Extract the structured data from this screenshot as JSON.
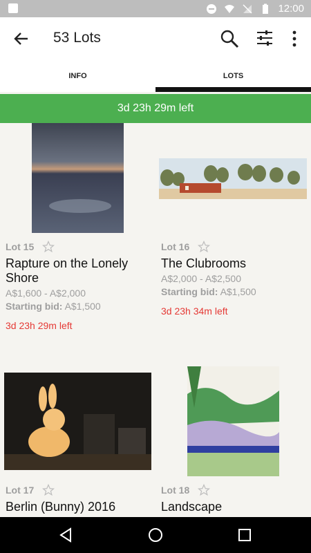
{
  "status_bar": {
    "time": "12:00"
  },
  "app_bar": {
    "title": "53 Lots"
  },
  "tabs": [
    {
      "label": "INFO"
    },
    {
      "label": "LOTS"
    }
  ],
  "banner": {
    "text": "3d 23h 29m left"
  },
  "lots": [
    {
      "lot": "Lot 15",
      "title": "Rapture on the Lonely Shore",
      "estimate": "A$1,600 - A$2,000",
      "starting_bid_label": "Starting bid:",
      "starting_bid": "A$1,500",
      "time_left": "3d 23h 29m left"
    },
    {
      "lot": "Lot 16",
      "title": "The Clubrooms",
      "estimate": "A$2,000 - A$2,500",
      "starting_bid_label": "Starting bid:",
      "starting_bid": "A$1,500",
      "time_left": "3d 23h 34m left"
    },
    {
      "lot": "Lot 17",
      "title": "Berlin (Bunny) 2016"
    },
    {
      "lot": "Lot 18",
      "title": "Landscape"
    }
  ],
  "colors": {
    "accent_green": "#4caf50",
    "time_red": "#e53935",
    "muted_gray": "#9e9e9e"
  }
}
